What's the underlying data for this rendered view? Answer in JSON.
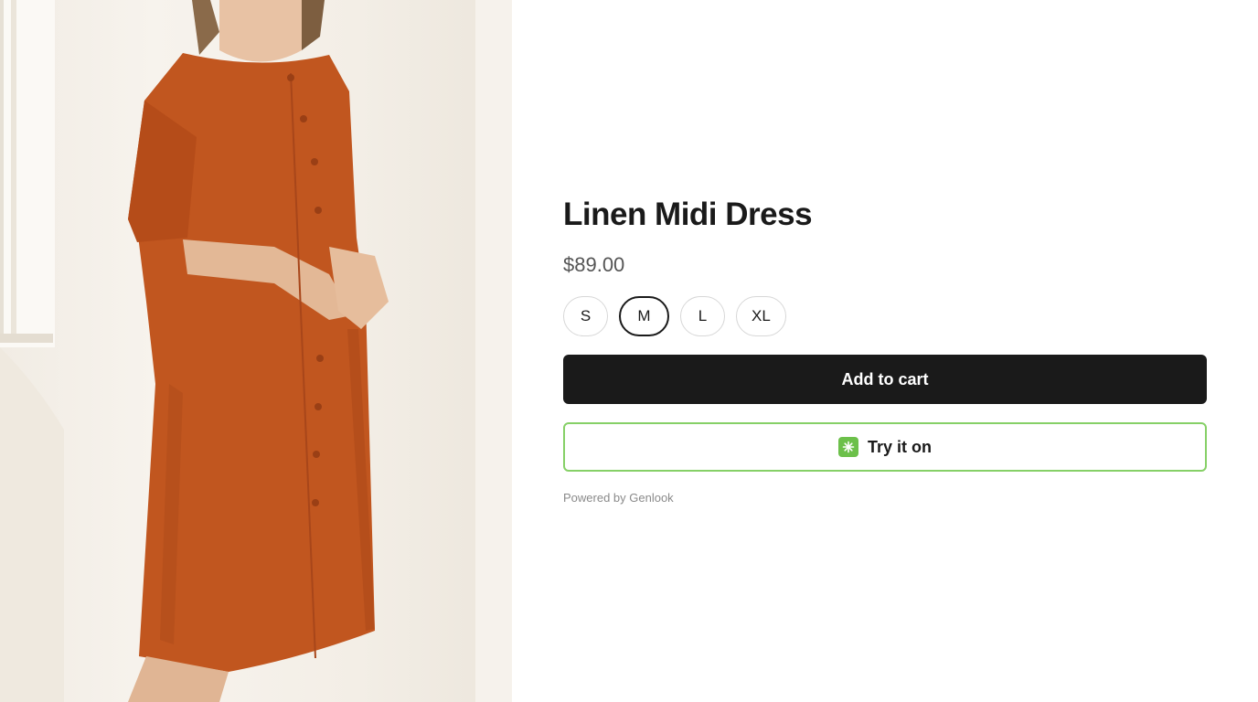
{
  "product": {
    "title": "Linen Midi Dress",
    "price": "$89.00",
    "image_alt": "woman wearing orange linen midi dress",
    "dress_color": "#c1561f"
  },
  "sizes": {
    "options": [
      "S",
      "M",
      "L",
      "XL"
    ],
    "selected": "M"
  },
  "actions": {
    "add_to_cart_label": "Add to cart",
    "try_on_label": "Try it on",
    "try_on_icon": "sparkle-icon",
    "try_on_accent": "#86d067"
  },
  "footer": {
    "powered_by": "Powered by Genlook"
  }
}
